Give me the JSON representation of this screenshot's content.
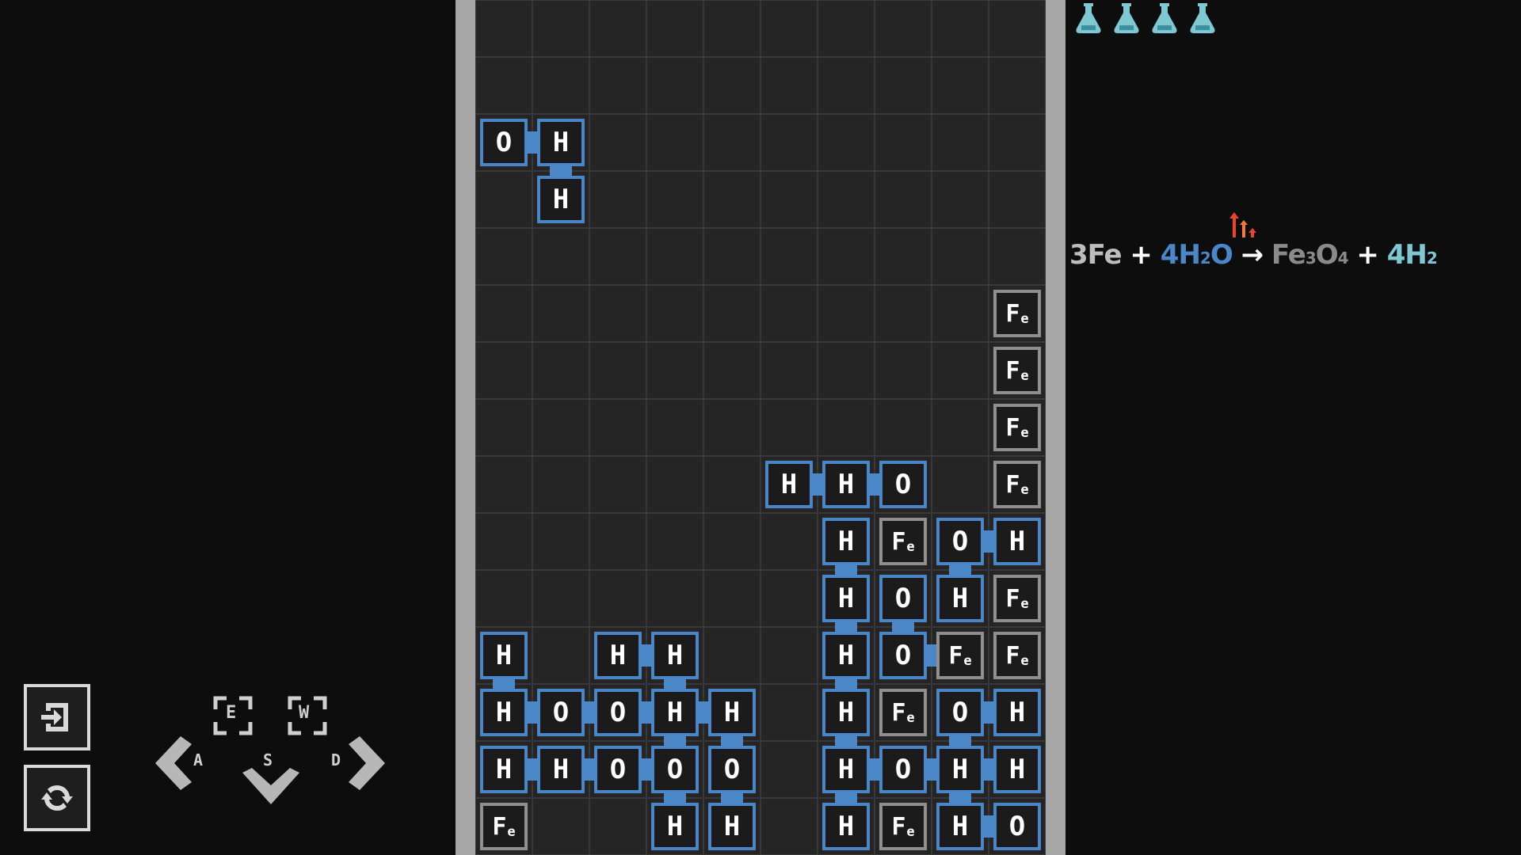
{
  "flasks": [
    "flask-icon",
    "flask-icon",
    "flask-icon",
    "flask-icon"
  ],
  "colors": {
    "water_blue": "#4a86c8",
    "iron_gray": "#8f8f8f",
    "accent_teal": "#7fc7d3",
    "arrow_red": "#e8452c"
  },
  "equation": {
    "c1": "3",
    "r1": "Fe",
    "plus1": " + ",
    "c2": "4",
    "r2a": "H",
    "r2sub": "2",
    "r2b": "O",
    "arrow": " → ",
    "p1a": "Fe",
    "p1s1": "3",
    "p1b": "O",
    "p1s2": "4",
    "plus2": " + ",
    "c3": "4",
    "p2": "H",
    "p2sub": "2"
  },
  "controls": {
    "rotate_e": "E",
    "rotate_w": "W",
    "left": "A",
    "down": "S",
    "right": "D"
  },
  "board": {
    "cols": 10,
    "rows": 15,
    "active_piece": [
      {
        "col": 0,
        "row": 2,
        "el": "O"
      },
      {
        "col": 1,
        "row": 2,
        "el": "H"
      },
      {
        "col": 1,
        "row": 3,
        "el": "H"
      }
    ],
    "cells": [
      {
        "col": 9,
        "row": 5,
        "el": "Fe"
      },
      {
        "col": 9,
        "row": 6,
        "el": "Fe"
      },
      {
        "col": 9,
        "row": 7,
        "el": "Fe"
      },
      {
        "col": 5,
        "row": 8,
        "el": "H"
      },
      {
        "col": 6,
        "row": 8,
        "el": "H"
      },
      {
        "col": 7,
        "row": 8,
        "el": "O"
      },
      {
        "col": 9,
        "row": 8,
        "el": "Fe"
      },
      {
        "col": 6,
        "row": 9,
        "el": "H"
      },
      {
        "col": 7,
        "row": 9,
        "el": "Fe"
      },
      {
        "col": 8,
        "row": 9,
        "el": "O"
      },
      {
        "col": 9,
        "row": 9,
        "el": "H"
      },
      {
        "col": 6,
        "row": 10,
        "el": "H"
      },
      {
        "col": 7,
        "row": 10,
        "el": "O"
      },
      {
        "col": 8,
        "row": 10,
        "el": "H"
      },
      {
        "col": 9,
        "row": 10,
        "el": "Fe"
      },
      {
        "col": 0,
        "row": 11,
        "el": "H"
      },
      {
        "col": 2,
        "row": 11,
        "el": "H"
      },
      {
        "col": 3,
        "row": 11,
        "el": "H"
      },
      {
        "col": 6,
        "row": 11,
        "el": "H"
      },
      {
        "col": 7,
        "row": 11,
        "el": "O"
      },
      {
        "col": 8,
        "row": 11,
        "el": "Fe"
      },
      {
        "col": 9,
        "row": 11,
        "el": "Fe"
      },
      {
        "col": 0,
        "row": 12,
        "el": "H"
      },
      {
        "col": 1,
        "row": 12,
        "el": "O"
      },
      {
        "col": 2,
        "row": 12,
        "el": "O"
      },
      {
        "col": 3,
        "row": 12,
        "el": "H"
      },
      {
        "col": 4,
        "row": 12,
        "el": "H"
      },
      {
        "col": 6,
        "row": 12,
        "el": "H"
      },
      {
        "col": 7,
        "row": 12,
        "el": "Fe"
      },
      {
        "col": 8,
        "row": 12,
        "el": "O"
      },
      {
        "col": 9,
        "row": 12,
        "el": "H"
      },
      {
        "col": 0,
        "row": 13,
        "el": "H"
      },
      {
        "col": 1,
        "row": 13,
        "el": "H"
      },
      {
        "col": 2,
        "row": 13,
        "el": "O"
      },
      {
        "col": 3,
        "row": 13,
        "el": "O"
      },
      {
        "col": 4,
        "row": 13,
        "el": "O"
      },
      {
        "col": 6,
        "row": 13,
        "el": "H"
      },
      {
        "col": 7,
        "row": 13,
        "el": "O"
      },
      {
        "col": 8,
        "row": 13,
        "el": "H"
      },
      {
        "col": 9,
        "row": 13,
        "el": "H"
      },
      {
        "col": 0,
        "row": 14,
        "el": "Fe"
      },
      {
        "col": 3,
        "row": 14,
        "el": "H"
      },
      {
        "col": 4,
        "row": 14,
        "el": "H"
      },
      {
        "col": 6,
        "row": 14,
        "el": "H"
      },
      {
        "col": 7,
        "row": 14,
        "el": "Fe"
      },
      {
        "col": 8,
        "row": 14,
        "el": "H"
      },
      {
        "col": 9,
        "row": 14,
        "el": "O"
      }
    ],
    "bonds": [
      {
        "col": 0,
        "row": 2,
        "dir": "h"
      },
      {
        "col": 1,
        "row": 2,
        "dir": "v"
      },
      {
        "col": 5,
        "row": 8,
        "dir": "h"
      },
      {
        "col": 6,
        "row": 8,
        "dir": "h"
      },
      {
        "col": 6,
        "row": 9,
        "dir": "v"
      },
      {
        "col": 8,
        "row": 9,
        "dir": "h"
      },
      {
        "col": 8,
        "row": 9,
        "dir": "v"
      },
      {
        "col": 6,
        "row": 10,
        "dir": "v"
      },
      {
        "col": 7,
        "row": 10,
        "dir": "v"
      },
      {
        "col": 6,
        "row": 11,
        "dir": "v"
      },
      {
        "col": 7,
        "row": 11,
        "dir": "h"
      },
      {
        "col": 0,
        "row": 11,
        "dir": "v"
      },
      {
        "col": 2,
        "row": 11,
        "dir": "h"
      },
      {
        "col": 3,
        "row": 11,
        "dir": "v"
      },
      {
        "col": 0,
        "row": 12,
        "dir": "h"
      },
      {
        "col": 1,
        "row": 12,
        "dir": "h"
      },
      {
        "col": 2,
        "row": 12,
        "dir": "h"
      },
      {
        "col": 3,
        "row": 12,
        "dir": "h"
      },
      {
        "col": 3,
        "row": 12,
        "dir": "v"
      },
      {
        "col": 4,
        "row": 12,
        "dir": "v"
      },
      {
        "col": 6,
        "row": 12,
        "dir": "v"
      },
      {
        "col": 8,
        "row": 12,
        "dir": "h"
      },
      {
        "col": 8,
        "row": 12,
        "dir": "v"
      },
      {
        "col": 0,
        "row": 13,
        "dir": "h"
      },
      {
        "col": 1,
        "row": 13,
        "dir": "h"
      },
      {
        "col": 2,
        "row": 13,
        "dir": "h"
      },
      {
        "col": 3,
        "row": 13,
        "dir": "v"
      },
      {
        "col": 4,
        "row": 13,
        "dir": "v"
      },
      {
        "col": 6,
        "row": 13,
        "dir": "v"
      },
      {
        "col": 6,
        "row": 13,
        "dir": "h"
      },
      {
        "col": 7,
        "row": 13,
        "dir": "h"
      },
      {
        "col": 8,
        "row": 13,
        "dir": "h"
      },
      {
        "col": 8,
        "row": 13,
        "dir": "v"
      },
      {
        "col": 8,
        "row": 14,
        "dir": "h"
      }
    ]
  }
}
